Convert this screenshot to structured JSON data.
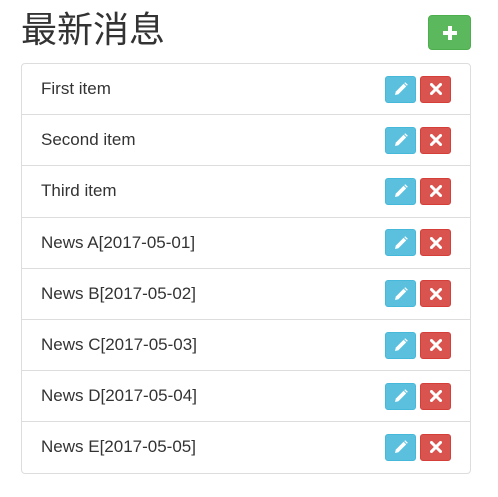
{
  "header": {
    "title": "最新消息",
    "add_icon": "plus-icon"
  },
  "list": {
    "edit_icon": "pencil-icon",
    "delete_icon": "x-icon",
    "items": [
      {
        "label": "First item"
      },
      {
        "label": "Second item"
      },
      {
        "label": "Third item"
      },
      {
        "label": "News A[2017-05-01]"
      },
      {
        "label": "News B[2017-05-02]"
      },
      {
        "label": "News C[2017-05-03]"
      },
      {
        "label": "News D[2017-05-04]"
      },
      {
        "label": "News E[2017-05-05]"
      }
    ]
  },
  "colors": {
    "add": "#5cb85c",
    "edit": "#5bc0de",
    "delete": "#d9534f",
    "border": "#dddddd"
  }
}
